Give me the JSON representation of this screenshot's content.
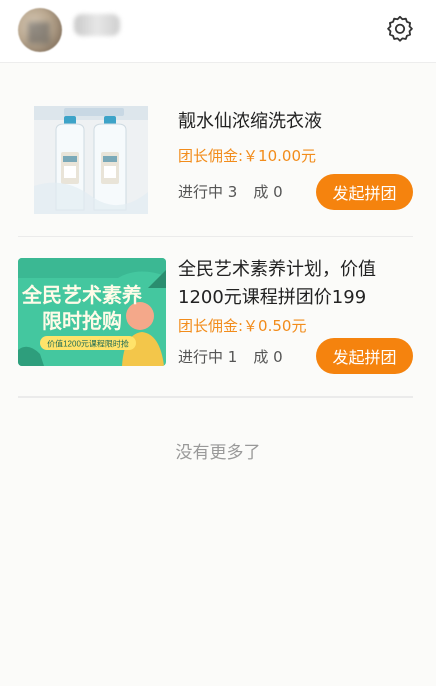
{
  "header": {
    "nickname": "",
    "settings_icon": "gear-icon"
  },
  "products": [
    {
      "title": "靓水仙浓缩洗衣液",
      "commission": "团长佣金:￥10.00元",
      "in_progress": "进行中 3",
      "done": "成 0",
      "button": "发起拼团"
    },
    {
      "title": "全民艺术素养计划，价值1200元课程拼团价199",
      "commission": "团长佣金:￥0.50元",
      "in_progress": "进行中 1",
      "done": "成 0",
      "button": "发起拼团",
      "banner": {
        "line1": "全民艺术素养",
        "line2": "限时抢购",
        "tag": "价值1200元课程限时抢"
      }
    }
  ],
  "footer": {
    "no_more": "没有更多了"
  },
  "colors": {
    "accent": "#f5830e",
    "commission": "#f28c1b",
    "banner_green": "#44c79f"
  }
}
